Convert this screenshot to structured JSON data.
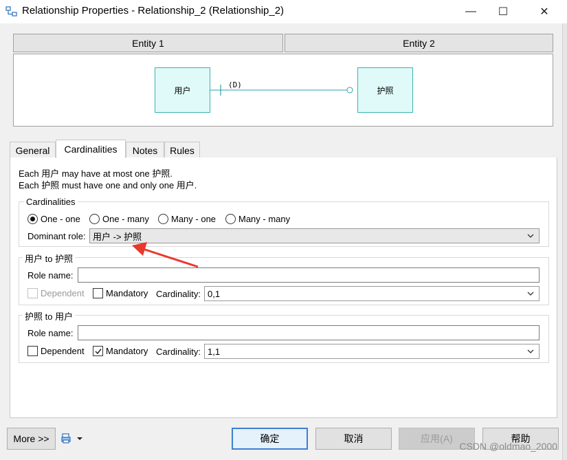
{
  "window": {
    "title": "Relationship Properties - Relationship_2 (Relationship_2)",
    "minimize": "—",
    "maximize": "☐",
    "close": "✕"
  },
  "entities": {
    "header1": "Entity 1",
    "header2": "Entity 2",
    "entity1_name": "用户",
    "entity2_name": "护照",
    "link_label": "(D)"
  },
  "tabs": [
    "General",
    "Cardinalities",
    "Notes",
    "Rules"
  ],
  "description": {
    "line1": "Each 用户 may have at most one 护照.",
    "line2": "Each 护照 must have one and only one 用户."
  },
  "cardinalities": {
    "group_label": "Cardinalities",
    "options": [
      "One - one",
      "One - many",
      "Many - one",
      "Many - many"
    ],
    "selected": "One - one",
    "dominant_role_label": "Dominant role:",
    "dominant_role_value": "用户 -> 护照"
  },
  "role1": {
    "group_label": "用户 to 护照",
    "role_name_label": "Role name:",
    "role_name_value": "",
    "dependent_label": "Dependent",
    "mandatory_label": "Mandatory",
    "cardinality_label": "Cardinality:",
    "cardinality_value": "0,1"
  },
  "role2": {
    "group_label": "护照 to 用户",
    "role_name_label": "Role name:",
    "role_name_value": "",
    "dependent_label": "Dependent",
    "mandatory_label": "Mandatory",
    "cardinality_label": "Cardinality:",
    "cardinality_value": "1,1"
  },
  "footer": {
    "more": "More >>",
    "ok": "确定",
    "cancel": "取消",
    "apply": "应用(A)",
    "help": "帮助"
  },
  "watermark": "CSDN @oldmao_2000",
  "colors": {
    "entity_fill": "#dffaf8",
    "entity_border": "#37b5b2",
    "link_line": "#2aa4a8",
    "annotation_arrow": "#e8392e",
    "default_button_border": "#3b7fd4"
  }
}
